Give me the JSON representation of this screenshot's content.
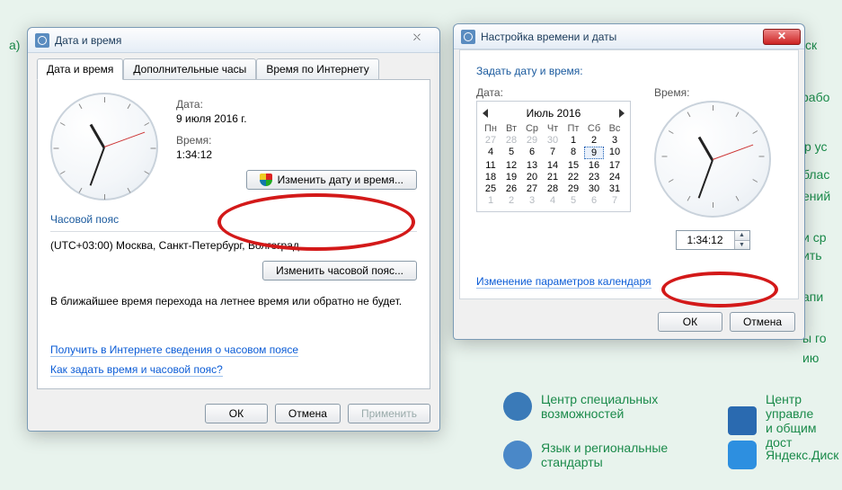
{
  "bg": {
    "item1": "Центр специальных возможностей",
    "item2": "Язык и региональные стандарты",
    "item3": "Центр управле",
    "item4": "и общим дост",
    "item5": "Яндекс.Диск",
    "frag_a": "а)",
    "frag_b": "ск",
    "frag_c": "рабо",
    "frag_d": "р ус",
    "frag_e": "блас",
    "frag_f": "ений",
    "frag_g": "и ср",
    "frag_h": "ить",
    "frag_i": "апи",
    "frag_j": "ы го",
    "frag_k": "ию"
  },
  "win1": {
    "title": "Дата и время",
    "tabs": [
      "Дата и время",
      "Дополнительные часы",
      "Время по Интернету"
    ],
    "date_label": "Дата:",
    "date_value": "9 июля 2016 г.",
    "time_label": "Время:",
    "time_value": "1:34:12",
    "change_dt_btn": "Изменить дату и время...",
    "tz_header": "Часовой пояс",
    "tz_value": "(UTC+03:00) Москва, Санкт-Петербург, Волгоград",
    "change_tz_btn": "Изменить часовой пояс...",
    "dst_note": "В ближайшее время перехода на летнее время или обратно не будет.",
    "link1": "Получить в Интернете сведения о часовом поясе",
    "link2": "Как задать время и часовой пояс?",
    "ok": "ОК",
    "cancel": "Отмена",
    "apply": "Применить"
  },
  "win2": {
    "title": "Настройка времени и даты",
    "heading": "Задать дату и время:",
    "date_label": "Дата:",
    "time_label": "Время:",
    "month": "Июль 2016",
    "dow": [
      "Пн",
      "Вт",
      "Ср",
      "Чт",
      "Пт",
      "Сб",
      "Вс"
    ],
    "prev_tail": [
      "27",
      "28",
      "29",
      "30",
      "1",
      "2",
      "3"
    ],
    "weeks": [
      [
        "4",
        "5",
        "6",
        "7",
        "8",
        "9",
        "10"
      ],
      [
        "11",
        "12",
        "13",
        "14",
        "15",
        "16",
        "17"
      ],
      [
        "18",
        "19",
        "20",
        "21",
        "22",
        "23",
        "24"
      ],
      [
        "25",
        "26",
        "27",
        "28",
        "29",
        "30",
        "31"
      ]
    ],
    "next_head": [
      "1",
      "2",
      "3",
      "4",
      "5",
      "6",
      "7"
    ],
    "selected_day": "9",
    "time_value": "1:34:12",
    "cal_link": "Изменение параметров календаря",
    "ok": "ОК",
    "cancel": "Отмена"
  }
}
